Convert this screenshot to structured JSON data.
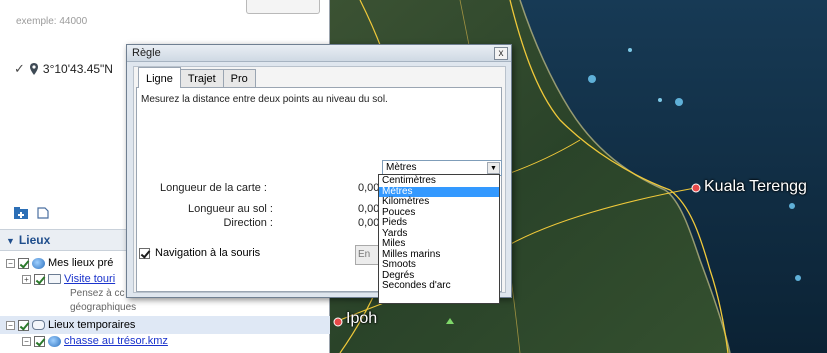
{
  "left_panel": {
    "hint_text": "exemple: 44000",
    "result_coord": "3°10'43.45\"N",
    "places_header": "Lieux",
    "tree": {
      "my_places": "Mes lieux pré",
      "visit_link": "Visite touri",
      "desc_line1": "Pensez à cc",
      "desc_line2": "géographiques",
      "temp_places": "Lieux temporaires",
      "treasure_link": "chasse au trésor.kmz"
    }
  },
  "map": {
    "labels": {
      "kuala": "Kuala Terengg",
      "ipoh": "Ipoh"
    },
    "colors": {
      "sea": "#10283d",
      "land": "#2f4a2c",
      "road": "#f0c93a"
    }
  },
  "dialog": {
    "title": "Règle",
    "close_glyph": "x",
    "tabs": [
      "Ligne",
      "Trajet",
      "Pro"
    ],
    "description": "Mesurez la distance entre deux points au niveau du sol.",
    "fields": {
      "map_length_label": "Longueur de la carte :",
      "map_length_value": "0,00",
      "ground_length_label": "Longueur au sol :",
      "ground_length_value": "0,00",
      "direction_label": "Direction :",
      "direction_value": "0,00"
    },
    "unit_selected": "Mètres",
    "unit_options": [
      "Centimètres",
      "Mètres",
      "Kilomètres",
      "Pouces",
      "Pieds",
      "Yards",
      "Miles",
      "Milles marins",
      "Smoots",
      "Degrés",
      "Secondes d'arc"
    ],
    "nav_mouse_label": "Navigation à la souris",
    "save_button_partial": "En"
  }
}
